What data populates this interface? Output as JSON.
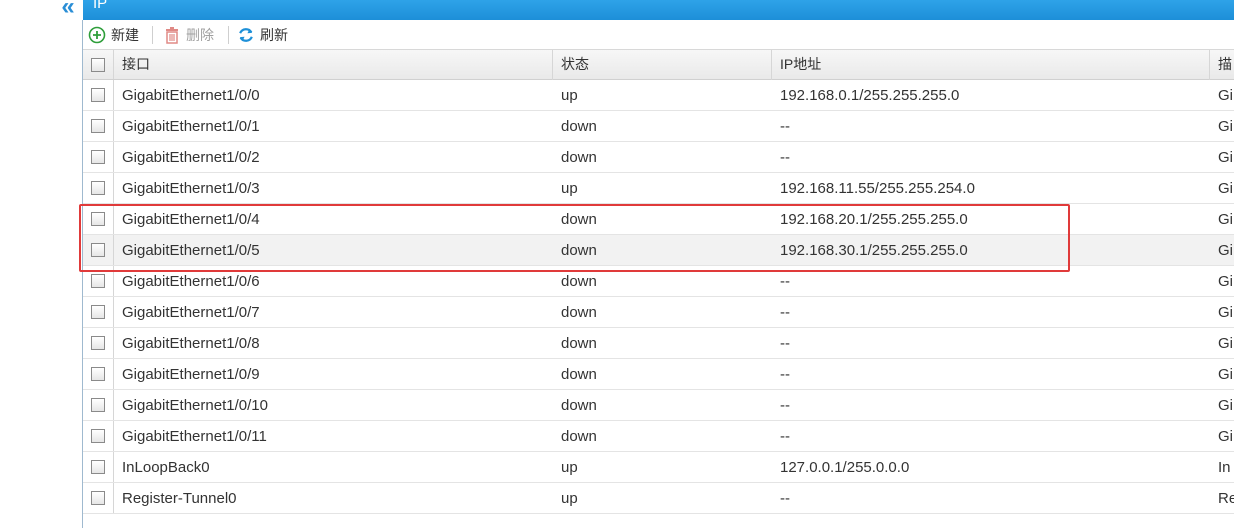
{
  "header": {
    "panel_title": "IP"
  },
  "toolbar": {
    "new_label": "新建",
    "delete_label": "删除",
    "refresh_label": "刷新"
  },
  "colors": {
    "accent": "#1e90d8",
    "highlight": "#e03a3a",
    "add_green": "#2e9e3a",
    "delete_red": "#d9534f"
  },
  "table": {
    "columns": [
      "接口",
      "状态",
      "IP地址",
      "描"
    ],
    "rows": [
      {
        "interface": "GigabitEthernet1/0/0",
        "status": "up",
        "ip": "192.168.0.1/255.255.255.0",
        "desc": "Gi"
      },
      {
        "interface": "GigabitEthernet1/0/1",
        "status": "down",
        "ip": "--",
        "desc": "Gi"
      },
      {
        "interface": "GigabitEthernet1/0/2",
        "status": "down",
        "ip": "--",
        "desc": "Gi"
      },
      {
        "interface": "GigabitEthernet1/0/3",
        "status": "up",
        "ip": "192.168.11.55/255.255.254.0",
        "desc": "Gi"
      },
      {
        "interface": "GigabitEthernet1/0/4",
        "status": "down",
        "ip": "192.168.20.1/255.255.255.0",
        "desc": "Gi"
      },
      {
        "interface": "GigabitEthernet1/0/5",
        "status": "down",
        "ip": "192.168.30.1/255.255.255.0",
        "desc": "Gi"
      },
      {
        "interface": "GigabitEthernet1/0/6",
        "status": "down",
        "ip": "--",
        "desc": "Gi"
      },
      {
        "interface": "GigabitEthernet1/0/7",
        "status": "down",
        "ip": "--",
        "desc": "Gi"
      },
      {
        "interface": "GigabitEthernet1/0/8",
        "status": "down",
        "ip": "--",
        "desc": "Gi"
      },
      {
        "interface": "GigabitEthernet1/0/9",
        "status": "down",
        "ip": "--",
        "desc": "Gi"
      },
      {
        "interface": "GigabitEthernet1/0/10",
        "status": "down",
        "ip": "--",
        "desc": "Gi"
      },
      {
        "interface": "GigabitEthernet1/0/11",
        "status": "down",
        "ip": "--",
        "desc": "Gi"
      },
      {
        "interface": "InLoopBack0",
        "status": "up",
        "ip": "127.0.0.1/255.0.0.0",
        "desc": "In"
      },
      {
        "interface": "Register-Tunnel0",
        "status": "up",
        "ip": "--",
        "desc": "Re"
      }
    ]
  }
}
